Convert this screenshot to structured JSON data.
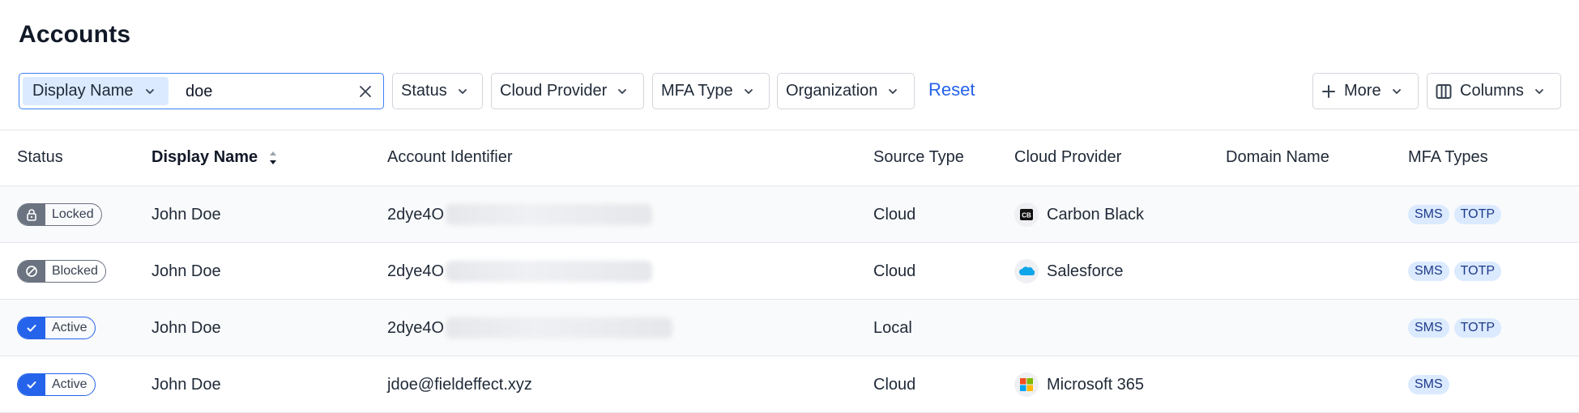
{
  "page": {
    "title": "Accounts"
  },
  "filters": {
    "field_select": "Display Name",
    "search_value": "doe",
    "dropdowns": [
      "Status",
      "Cloud Provider",
      "MFA Type",
      "Organization"
    ],
    "reset_label": "Reset",
    "more_label": "More",
    "columns_label": "Columns"
  },
  "table": {
    "columns": [
      "Status",
      "Display Name",
      "Account Identifier",
      "Source Type",
      "Cloud Provider",
      "Domain Name",
      "MFA Types"
    ],
    "sorted_column": "Display Name",
    "rows": [
      {
        "status": "Locked",
        "status_icon": "lock-icon",
        "display_name": "John Doe",
        "account_identifier": "2dye4O",
        "identifier_redacted": true,
        "source_type": "Cloud",
        "cloud_provider": "Carbon Black",
        "provider_icon": "carbon-black-icon",
        "domain_name": "",
        "mfa_types": [
          "SMS",
          "TOTP"
        ]
      },
      {
        "status": "Blocked",
        "status_icon": "blocked-icon",
        "display_name": "John Doe",
        "account_identifier": "2dye4O",
        "identifier_redacted": true,
        "source_type": "Cloud",
        "cloud_provider": "Salesforce",
        "provider_icon": "salesforce-icon",
        "domain_name": "",
        "mfa_types": [
          "SMS",
          "TOTP"
        ]
      },
      {
        "status": "Active",
        "status_icon": "check-icon",
        "display_name": "John Doe",
        "account_identifier": "2dye4O",
        "identifier_redacted": true,
        "source_type": "Local",
        "cloud_provider": "",
        "provider_icon": "",
        "domain_name": "",
        "mfa_types": [
          "SMS",
          "TOTP"
        ]
      },
      {
        "status": "Active",
        "status_icon": "check-icon",
        "display_name": "John Doe",
        "account_identifier": "jdoe@fieldeffect.xyz",
        "identifier_redacted": false,
        "source_type": "Cloud",
        "cloud_provider": "Microsoft 365",
        "provider_icon": "microsoft-icon",
        "domain_name": "",
        "mfa_types": [
          "SMS"
        ]
      }
    ]
  },
  "colors": {
    "accent": "#2563eb",
    "focus_border": "#3b82f6",
    "tag_bg": "#dbeafe",
    "tag_text": "#1e3a8a",
    "locked_badge": "#6b7280",
    "active_badge": "#2563eb"
  }
}
